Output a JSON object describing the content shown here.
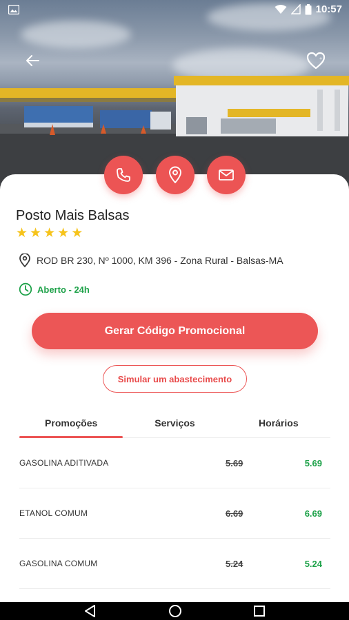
{
  "status_bar": {
    "time": "10:57"
  },
  "station": {
    "name": "Posto Mais Balsas",
    "rating": 5,
    "address": "ROD BR 230, Nº 1000, KM 396 - Zona Rural - Balsas-MA",
    "hours": "Aberto - 24h"
  },
  "actions": {
    "promo_button": "Gerar Código Promocional",
    "simulate_button": "Simular um abastecimento"
  },
  "tabs": [
    {
      "label": "Promoções",
      "active": true
    },
    {
      "label": "Serviços",
      "active": false
    },
    {
      "label": "Horários",
      "active": false
    }
  ],
  "promotions": [
    {
      "name": "GASOLINA ADITIVADA",
      "old_price": "5.69",
      "new_price": "5.69"
    },
    {
      "name": "ETANOL COMUM",
      "old_price": "6.69",
      "new_price": "6.69"
    },
    {
      "name": "GASOLINA COMUM",
      "old_price": "5.24",
      "new_price": "5.24"
    }
  ],
  "colors": {
    "accent": "#ec5454",
    "open": "#1fa24a",
    "star": "#f6c31b"
  },
  "icons": {
    "back": "arrow-left-icon",
    "favorite": "heart-icon",
    "phone": "phone-icon",
    "location": "location-pin-icon",
    "email": "mail-icon",
    "address": "location-outline-icon",
    "clock": "clock-icon"
  }
}
